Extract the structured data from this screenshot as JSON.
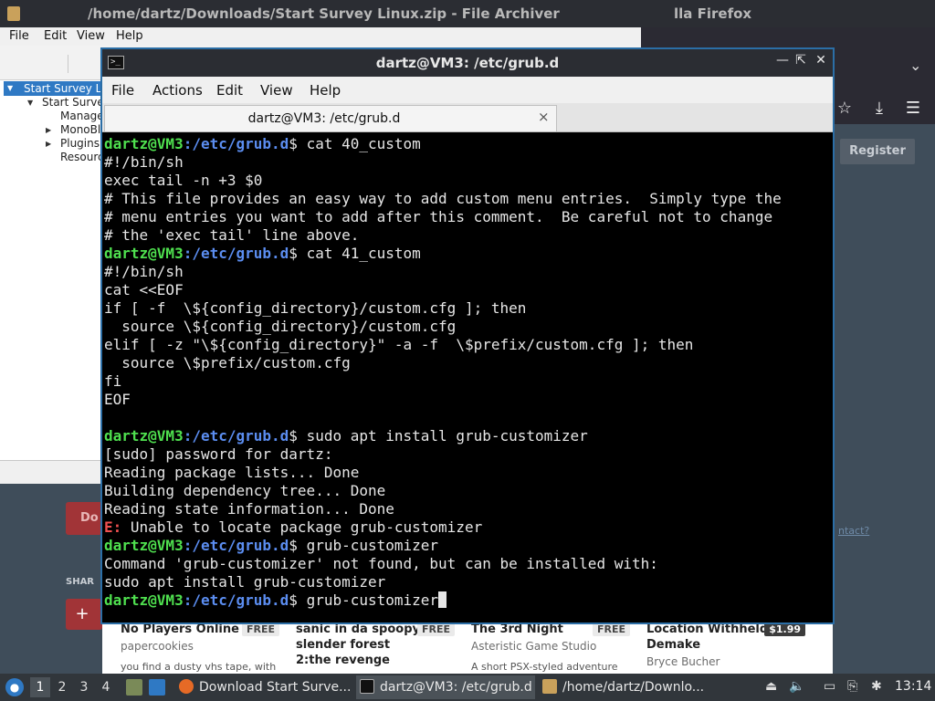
{
  "archiver": {
    "title": "/home/dartz/Downloads/Start Survey Linux.zip - File Archiver",
    "menu": [
      "File",
      "Edit",
      "View",
      "Help"
    ],
    "tree": [
      "Start Survey L",
      "Start Surve",
      "Manage",
      "MonoBl",
      "Plugins",
      "Resourc"
    ]
  },
  "firefox": {
    "title_fragment": "lla Firefox",
    "register_label": "Register",
    "red_button_label": "Do",
    "share_label": "SHAR",
    "plus_label": "+",
    "side_link": "ntact?",
    "games": [
      {
        "title": "No Players Online",
        "price": "FREE",
        "author": "papercookies",
        "desc": "you find a dusty vhs tape, with"
      },
      {
        "title": "sanic in da spoopy slender forest 2:the revenge",
        "price": "FREE",
        "author": "",
        "desc": ""
      },
      {
        "title": "The 3rd Night",
        "price": "FREE",
        "author": "Asteristic Game Studio",
        "desc": "A short PSX-styled adventure"
      },
      {
        "title": "Location Withheld Demake",
        "price": "$1.99",
        "author": "Bryce Bucher",
        "desc": ""
      }
    ]
  },
  "terminal": {
    "title": "dartz@VM3: /etc/grub.d",
    "menu": [
      "File",
      "Actions",
      "Edit",
      "View",
      "Help"
    ],
    "tab_label": "dartz@VM3: /etc/grub.d",
    "tab_close": "×",
    "prompt_user": "dartz@VM3",
    "prompt_path": ":/etc/grub.d",
    "lines": [
      {
        "type": "prompt",
        "text": "$ cat 40_custom"
      },
      {
        "type": "out",
        "text": "#!/bin/sh"
      },
      {
        "type": "out",
        "text": "exec tail -n +3 $0"
      },
      {
        "type": "out",
        "text": "# This file provides an easy way to add custom menu entries.  Simply type the"
      },
      {
        "type": "out",
        "text": "# menu entries you want to add after this comment.  Be careful not to change"
      },
      {
        "type": "out",
        "text": "# the 'exec tail' line above."
      },
      {
        "type": "prompt",
        "text": "$ cat 41_custom"
      },
      {
        "type": "out",
        "text": "#!/bin/sh"
      },
      {
        "type": "out",
        "text": "cat <<EOF"
      },
      {
        "type": "out",
        "text": "if [ -f  \\${config_directory}/custom.cfg ]; then"
      },
      {
        "type": "out",
        "text": "  source \\${config_directory}/custom.cfg"
      },
      {
        "type": "out",
        "text": "elif [ -z \"\\${config_directory}\" -a -f  \\$prefix/custom.cfg ]; then"
      },
      {
        "type": "out",
        "text": "  source \\$prefix/custom.cfg"
      },
      {
        "type": "out",
        "text": "fi"
      },
      {
        "type": "out",
        "text": "EOF"
      },
      {
        "type": "out",
        "text": ""
      },
      {
        "type": "prompt",
        "text": "$ sudo apt install grub-customizer"
      },
      {
        "type": "out",
        "text": "[sudo] password for dartz:"
      },
      {
        "type": "out",
        "text": "Reading package lists... Done"
      },
      {
        "type": "out",
        "text": "Building dependency tree... Done"
      },
      {
        "type": "out",
        "text": "Reading state information... Done"
      },
      {
        "type": "error",
        "prefix": "E:",
        "text": " Unable to locate package grub-customizer"
      },
      {
        "type": "prompt",
        "text": "$ grub-customizer"
      },
      {
        "type": "out",
        "text": "Command 'grub-customizer' not found, but can be installed with:"
      },
      {
        "type": "out",
        "text": "sudo apt install grub-customizer"
      },
      {
        "type": "prompt",
        "text": "$ grub-customizer",
        "cursor": true
      }
    ]
  },
  "taskbar": {
    "workspaces": [
      "1",
      "2",
      "3",
      "4"
    ],
    "tasks": [
      "Download Start Surve...",
      "dartz@VM3: /etc/grub.d",
      "/home/dartz/Downlo..."
    ],
    "clock": "13:14"
  }
}
